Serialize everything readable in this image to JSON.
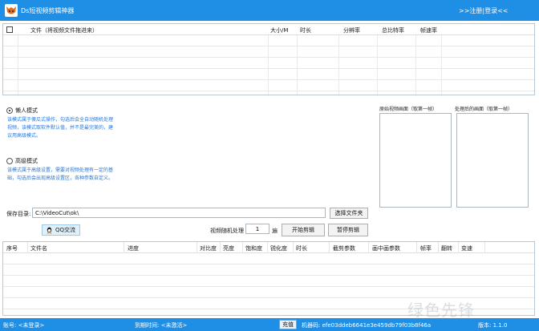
{
  "titlebar": {
    "title": "Ds短视频剪辑神器",
    "links": ">>注册|登录<<",
    "bg_color": "#1f8fe6"
  },
  "file_table": {
    "columns": [
      "文件（将视频文件拖进来）",
      "大小/M",
      "时长",
      "分辨率",
      "总比特率",
      "帧速率"
    ]
  },
  "modes": {
    "lazy_label": "懒人模式",
    "lazy_desc": "该模式属于傻瓜式操作，勾选后会全自动随机处理视频，该模式取软件默认值，并不是最完美的，建议用高级模式。",
    "advanced_label": "高级模式",
    "advanced_desc": "该模式属于高级设置，需要对视频处理有一定的基础，勾选后会出现高级设置区，各种参数自定义。",
    "desc_color": "#2a78d4"
  },
  "preview": {
    "original_label": "原始视频画面（取第一帧）",
    "processed_label": "处理后的画面（取第一帧）"
  },
  "save": {
    "label": "保存目录:",
    "path": "C:\\VideoCut\\ok\\",
    "select_folder": "选择文件夹"
  },
  "controls": {
    "qq_label": "QQ交流",
    "random_label": "视频随机处理",
    "random_value": "1",
    "random_unit": "遍",
    "start_button": "开始剪辑",
    "pause_button": "暂停剪辑"
  },
  "task_table": {
    "columns": [
      "序号",
      "文件名",
      "进度",
      "对比度",
      "亮度",
      "饱和度",
      "锐化度",
      "时长",
      "截剪参数",
      "画中画参数",
      "帧率",
      "翻转",
      "变速"
    ]
  },
  "status": {
    "account": "账号: <未登录>",
    "expiry": "到期时间: <未激活>",
    "charge": "充值",
    "machine": "机器码: efe03ddeb6641e3e459db79f03b8f46a",
    "version": "版本: 1.1.0"
  },
  "watermark": "绿色先锋"
}
